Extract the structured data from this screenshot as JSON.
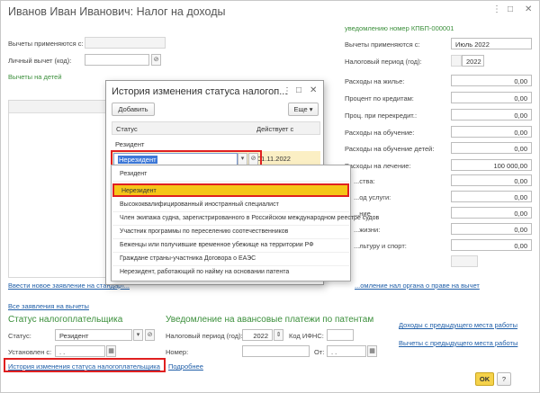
{
  "window": {
    "title": "Иванов Иван Иванович: Налог на доходы",
    "controls": [
      "⋮",
      "□",
      "✕"
    ]
  },
  "left": {
    "deductions_from_label": "Вычеты применяются с:",
    "personal_deduction_label": "Личный вычет (код):",
    "children_deductions_link": "Вычеты на детей",
    "new_app_link": "Ввести новое заявление на стандарт...",
    "all_apps_link": "Все заявления на вычеты"
  },
  "right": {
    "notice_label": "уведомлению номер КПБП-000001",
    "deductions_from_label": "Вычеты применяются с:",
    "deductions_from_value": "Июль 2022",
    "tax_period_label": "Налоговый период (год):",
    "tax_period_value": "2022",
    "rows": [
      {
        "label": "Расходы на жилье:",
        "value": "0,00"
      },
      {
        "label": "Процент по кредитам:",
        "value": "0,00"
      },
      {
        "label": "Проц. при перекредит.:",
        "value": "0,00"
      },
      {
        "label": "Расходы на обучение:",
        "value": "0,00"
      },
      {
        "label": "Расходы на обучение детей:",
        "value": "0,00"
      },
      {
        "label": "Расходы на лечение:",
        "value": "100 000,00"
      },
      {
        "label": "...ства:",
        "value": "0,00"
      },
      {
        "label": "...од услуги:",
        "value": "0,00"
      },
      {
        "label": "...ние",
        "value": "0,00"
      },
      {
        "label": "...жизни:",
        "value": "0,00"
      },
      {
        "label": "...льтуру и спорт:",
        "value": "0,00"
      }
    ],
    "tax_authority_link": "...омление нал органа о праве на вычет"
  },
  "bottom": {
    "status_section_title": "Статус налогоплательщика",
    "status_label": "Статус:",
    "status_value": "Резидент",
    "established_label": "Установлен с:",
    "established_value": ". .",
    "history_link": "История изменения статуса налогоплательщика",
    "more_link": "Подробнее",
    "advance_section_title": "Уведомление на авансовые платежи по патентам",
    "advance_period_label": "Налоговый период (год):",
    "advance_period_value": "2022",
    "ifns_label": "Код ИФНС:",
    "number_label": "Номер:",
    "from_label": "От:",
    "from_value": ". .",
    "prev_income_link": "Доходы с предыдущего места работы",
    "prev_deductions_link": "Вычеты с предыдущего места работы",
    "ok_label": "OK",
    "help_label": "?"
  },
  "dialog": {
    "title": "История изменения статуса налогоп...",
    "controls": [
      "⋮",
      "□",
      "✕"
    ],
    "add_button": "Добавить",
    "more_button": "Еще",
    "col_status": "Статус",
    "col_effective": "Действует с",
    "row1_status": "Резидент",
    "row2_status": "Нерезидент",
    "row2_date": "01.11.2022"
  },
  "dropdown": {
    "items": [
      "Резидент",
      "Нерезидент",
      "Высококвалифицированный иностранный специалист",
      "Член экипажа судна, зарегистрированного в Российском международном реестре судов",
      "Участник программы по переселению соотечественников",
      "Беженцы или получившие временное убежище на территории РФ",
      "Граждане страны-участника Договора о ЕАЭС",
      "Нерезидент, работающий по найму на основании патента"
    ],
    "selected_index": 1
  },
  "colors": {
    "accent_green": "#3b8f3b",
    "link_blue": "#1f5ea8",
    "highlight_red": "#e02020",
    "selection_yellow": "#f5c518",
    "ok_yellow": "#f5d24a"
  }
}
